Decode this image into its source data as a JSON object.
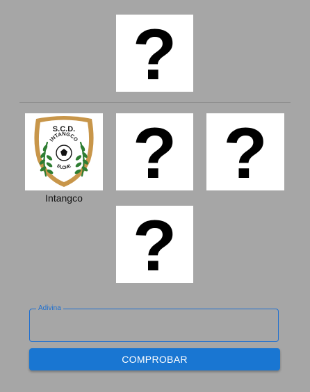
{
  "target": {
    "symbol": "?"
  },
  "grid": {
    "revealed": {
      "name": "Intangco",
      "crest_top_text": "S.C.D.",
      "crest_arc_text": "INTANGCO",
      "crest_bottom_text": "ELCHE"
    },
    "hidden_symbol": "?"
  },
  "form": {
    "legend": "Adivina",
    "value": "",
    "submit_label": "COMPROBAR"
  },
  "colors": {
    "background": "#a6a6a6",
    "accent": "#1976d2",
    "crest_gold": "#c8964a",
    "crest_green": "#2e7d32"
  }
}
